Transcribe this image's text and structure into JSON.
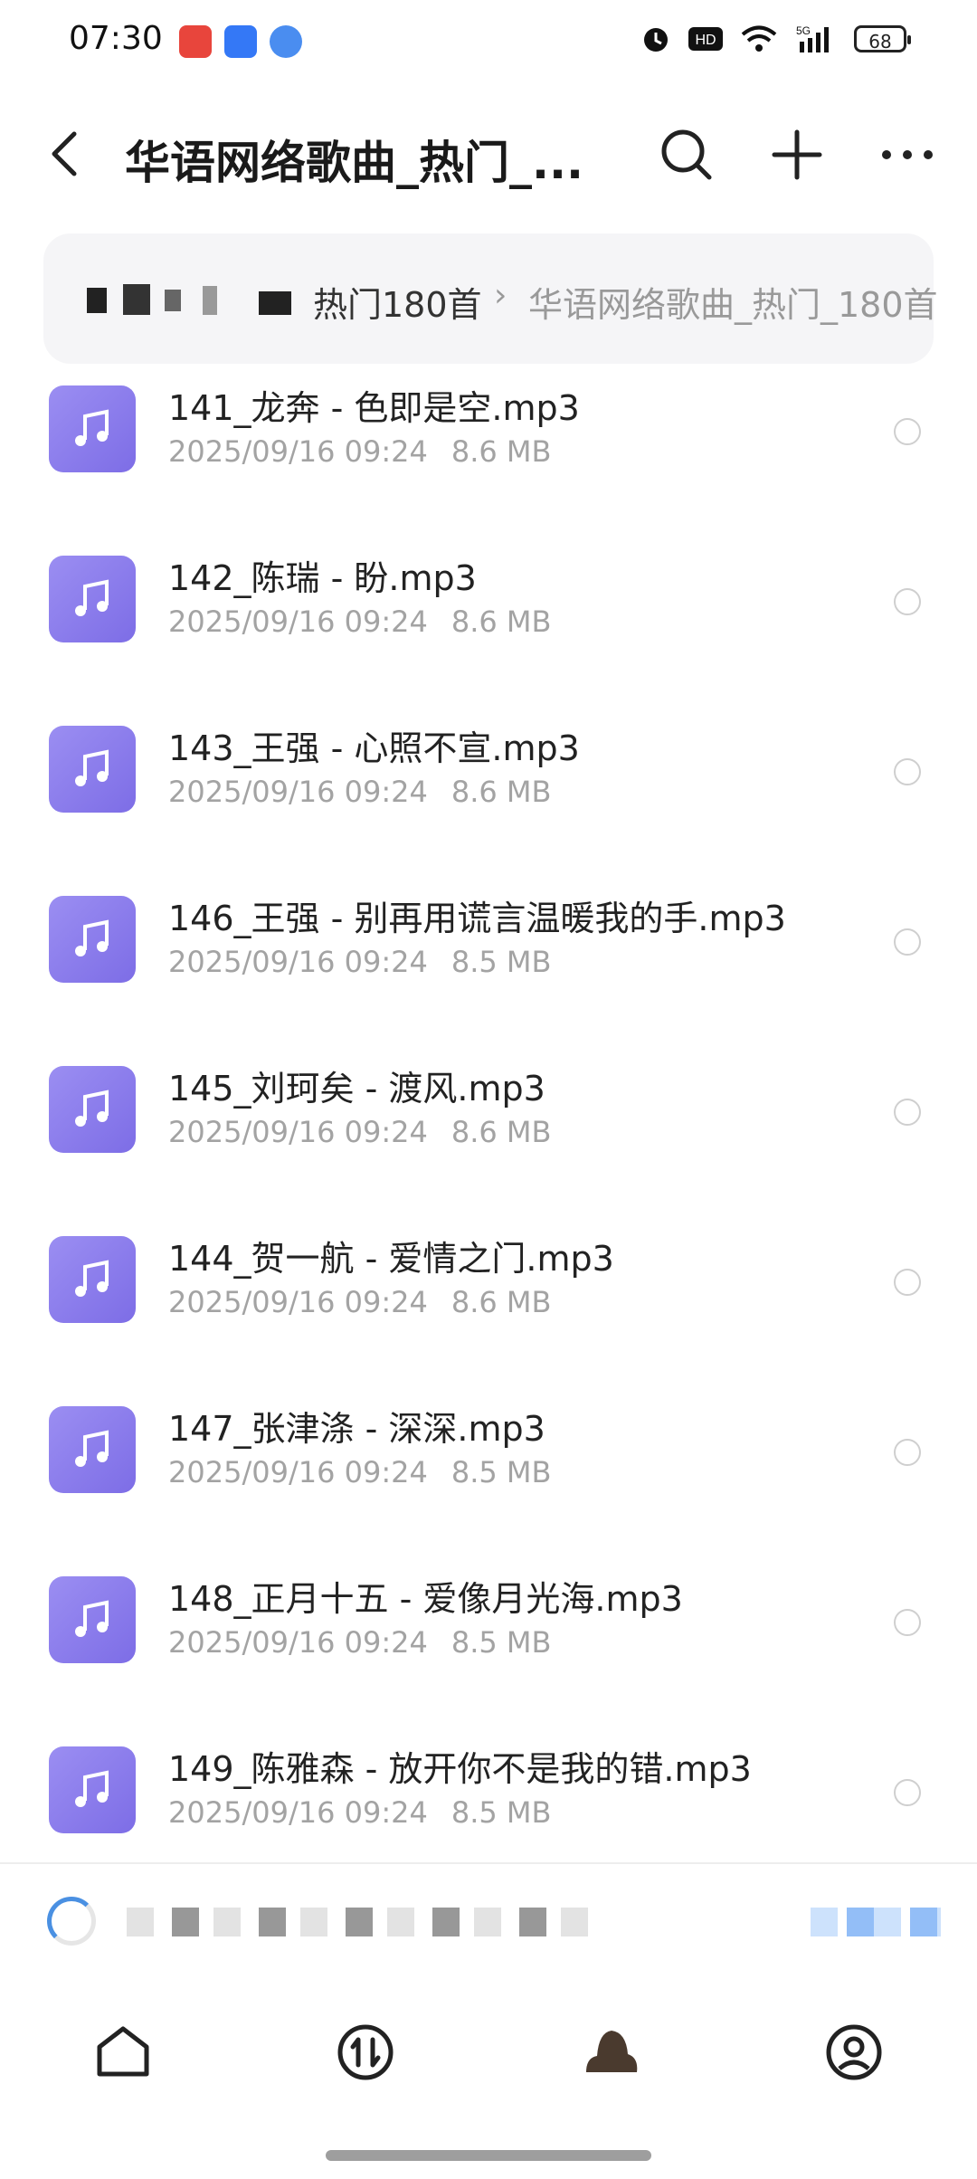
{
  "status_bar": {
    "time": "07:30",
    "battery": "68",
    "icons": [
      "toutiao-icon",
      "lark-icon",
      "app-icon",
      "alarm-icon",
      "hd-icon",
      "wifi-icon",
      "5g-signal-icon"
    ]
  },
  "header": {
    "title": "华语网络歌曲_热门_...",
    "icons": [
      "back-icon",
      "search-icon",
      "plus-icon",
      "more-icon"
    ]
  },
  "breadcrumb": {
    "parent": "热门180首",
    "separator": "›",
    "current": "华语网络歌曲_热门_180首"
  },
  "files": [
    {
      "name": "141_龙奔 - 色即是空.mp3",
      "date": "2025/09/16 09:24",
      "size": "8.6 MB"
    },
    {
      "name": "142_陈瑞 - 盼.mp3",
      "date": "2025/09/16 09:24",
      "size": "8.6 MB"
    },
    {
      "name": "143_王强 - 心照不宣.mp3",
      "date": "2025/09/16 09:24",
      "size": "8.6 MB"
    },
    {
      "name": "146_王强 - 别再用谎言温暖我的手.mp3",
      "date": "2025/09/16 09:24",
      "size": "8.5 MB"
    },
    {
      "name": "145_刘珂矣 - 渡风.mp3",
      "date": "2025/09/16 09:24",
      "size": "8.6 MB"
    },
    {
      "name": "144_贺一航 - 爱情之门.mp3",
      "date": "2025/09/16 09:24",
      "size": "8.6 MB"
    },
    {
      "name": "147_张津涤 - 深深.mp3",
      "date": "2025/09/16 09:24",
      "size": "8.5 MB"
    },
    {
      "name": "148_正月十五 - 爱像月光海.mp3",
      "date": "2025/09/16 09:24",
      "size": "8.5 MB"
    },
    {
      "name": "149_陈雅森 - 放开你不是我的错.mp3",
      "date": "2025/09/16 09:24",
      "size": "8.5 MB"
    }
  ],
  "tabs": [
    "home-icon",
    "transfer-icon",
    "cloud-icon",
    "profile-icon"
  ],
  "colors": {
    "file_icon": "#8b7cec",
    "accent": "#4a90e2",
    "meta_text": "#a3a3a3"
  }
}
